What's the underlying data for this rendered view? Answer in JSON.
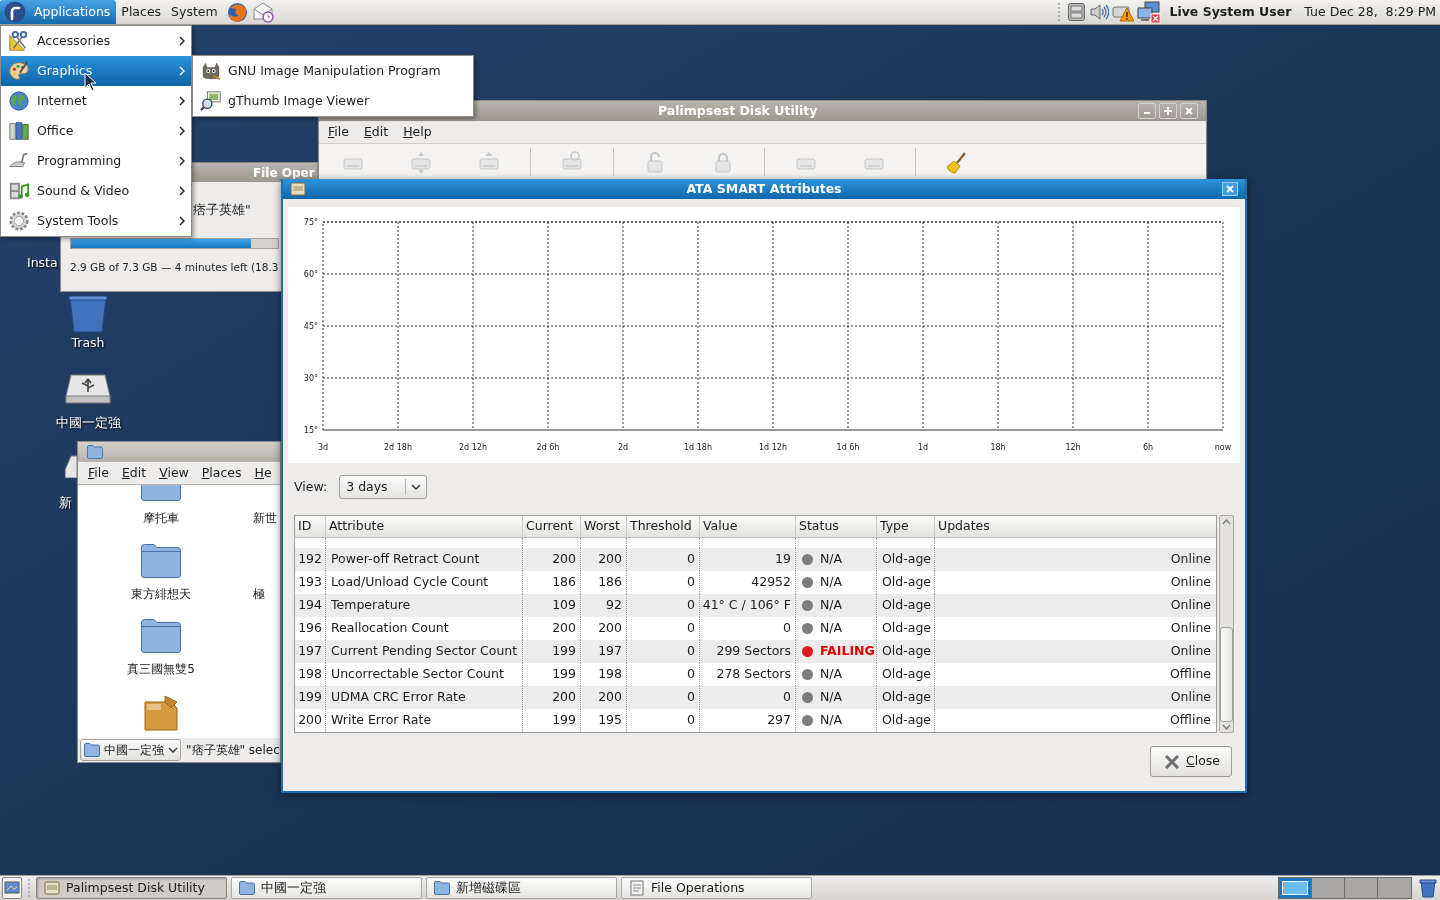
{
  "top_panel": {
    "menus": [
      {
        "label": "Applications",
        "selected": true
      },
      {
        "label": "Places",
        "selected": false
      },
      {
        "label": "System",
        "selected": false
      }
    ],
    "user": "Live System User",
    "clock": "Tue Dec 28,  8:29 PM"
  },
  "applications_menu": {
    "items": [
      {
        "label": "Accessories",
        "selected": false
      },
      {
        "label": "Graphics",
        "selected": true
      },
      {
        "label": "Internet",
        "selected": false
      },
      {
        "label": "Office",
        "selected": false
      },
      {
        "label": "Programming",
        "selected": false
      },
      {
        "label": "Sound & Video",
        "selected": false
      },
      {
        "label": "System Tools",
        "selected": false
      }
    ]
  },
  "graphics_submenu": {
    "items": [
      {
        "label": "GNU Image Manipulation Program"
      },
      {
        "label": "gThumb Image Viewer"
      }
    ]
  },
  "desktop_icons": [
    {
      "label": "Insta"
    },
    {
      "label": "Trash",
      "kind": "trash"
    },
    {
      "label": "中國一定強",
      "kind": "usb-drive"
    },
    {
      "label": "新",
      "kind": "drive"
    }
  ],
  "file_operations_window": {
    "title": "File Oper",
    "item": "痞子英雄\"",
    "progress": {
      "level": 0.87
    },
    "status": "2.9 GB of 7.3 GB — 4 minutes left (18.3"
  },
  "disk_utility_window": {
    "title": "Palimpsest Disk Utility",
    "menus": [
      "File",
      "Edit",
      "Help"
    ],
    "toolbar": [
      {
        "disabled": true
      },
      {
        "disabled": true
      },
      {
        "disabled": true
      },
      {
        "disabled": true
      },
      {
        "disabled": true
      },
      {
        "disabled": true
      },
      {
        "disabled": true
      },
      {
        "disabled": true
      },
      {
        "disabled": false
      }
    ]
  },
  "file_browser_window": {
    "menus": [
      "File",
      "Edit",
      "View",
      "Places",
      "He"
    ],
    "file_rows": [
      {
        "items": [
          {
            "label": "摩托車",
            "kind": "folder"
          },
          {
            "label": "新世"
          }
        ]
      },
      {
        "items": [
          {
            "label": "東方緋想天",
            "kind": "folder"
          },
          {
            "label": "極"
          }
        ]
      },
      {
        "items": [
          {
            "label": "真三國無雙5",
            "kind": "folder"
          }
        ]
      },
      {
        "items": [
          {
            "kind": "package"
          }
        ]
      }
    ],
    "location": "中國一定強",
    "status": "\"痞子英雄\" selec"
  },
  "smart_dialog": {
    "title": "ATA SMART Attributes",
    "chart_data": {
      "type": "line",
      "grid": true,
      "categories": [
        "3d",
        "2d 18h",
        "2d 12h",
        "2d 6h",
        "2d",
        "1d 18h",
        "1d 12h",
        "1d 6h",
        "1d",
        "18h",
        "12h",
        "6h",
        "now"
      ],
      "ylim": [
        15,
        75
      ],
      "yticks": [
        {
          "value": 75,
          "label": "75°"
        },
        {
          "value": 60,
          "label": "60°"
        },
        {
          "value": 45,
          "label": "45°"
        },
        {
          "value": 30,
          "label": "30°"
        },
        {
          "value": 15,
          "label": "15°"
        }
      ]
    },
    "view": {
      "label": "View:",
      "value": "3 days"
    },
    "table": {
      "columns": [
        "ID",
        "Attribute",
        "Current",
        "Worst",
        "Threshold",
        "Value",
        "Status",
        "Type",
        "Updates"
      ],
      "rows": [
        {
          "id": "192",
          "attribute": "Power-off Retract Count",
          "current": "200",
          "worst": "200",
          "threshold": "0",
          "value": "19",
          "status": "N/A",
          "color": "#7d7d7d",
          "failing": false,
          "type": "Old-age",
          "updates": "Online"
        },
        {
          "id": "193",
          "attribute": "Load/Unload Cycle Count",
          "current": "186",
          "worst": "186",
          "threshold": "0",
          "value": "42952",
          "status": "N/A",
          "color": "#7d7d7d",
          "failing": false,
          "type": "Old-age",
          "updates": "Online"
        },
        {
          "id": "194",
          "attribute": "Temperature",
          "current": "109",
          "worst": "92",
          "threshold": "0",
          "value": "41° C / 106° F",
          "status": "N/A",
          "color": "#7d7d7d",
          "failing": false,
          "type": "Old-age",
          "updates": "Online"
        },
        {
          "id": "196",
          "attribute": "Reallocation Count",
          "current": "200",
          "worst": "200",
          "threshold": "0",
          "value": "0",
          "status": "N/A",
          "color": "#7d7d7d",
          "failing": false,
          "type": "Old-age",
          "updates": "Online"
        },
        {
          "id": "197",
          "attribute": "Current Pending Sector Count",
          "current": "199",
          "worst": "197",
          "threshold": "0",
          "value": "299 Sectors",
          "status": "FAILING",
          "color": "#e01b1b",
          "failing": true,
          "type": "Old-age",
          "updates": "Online"
        },
        {
          "id": "198",
          "attribute": "Uncorrectable Sector Count",
          "current": "199",
          "worst": "198",
          "threshold": "0",
          "value": "278 Sectors",
          "status": "N/A",
          "color": "#7d7d7d",
          "failing": false,
          "type": "Old-age",
          "updates": "Offline"
        },
        {
          "id": "199",
          "attribute": "UDMA CRC Error Rate",
          "current": "200",
          "worst": "200",
          "threshold": "0",
          "value": "0",
          "status": "N/A",
          "color": "#7d7d7d",
          "failing": false,
          "type": "Old-age",
          "updates": "Online"
        },
        {
          "id": "200",
          "attribute": "Write Error Rate",
          "current": "199",
          "worst": "195",
          "threshold": "0",
          "value": "297",
          "status": "N/A",
          "color": "#7d7d7d",
          "failing": false,
          "type": "Old-age",
          "updates": "Offline"
        }
      ]
    },
    "close_button": "Close"
  },
  "taskbar": {
    "tasks": [
      {
        "label": "Palimpsest Disk Utility",
        "kind": "disk",
        "selected": true
      },
      {
        "label": "中國一定強",
        "kind": "folder",
        "selected": false
      },
      {
        "label": "新增磁碟區",
        "kind": "folder",
        "selected": false
      },
      {
        "label": "File Operations",
        "kind": "dialog",
        "selected": false
      }
    ],
    "workspaces": [
      {
        "selected": true
      },
      {
        "selected": false
      },
      {
        "selected": false
      },
      {
        "selected": false
      }
    ]
  }
}
